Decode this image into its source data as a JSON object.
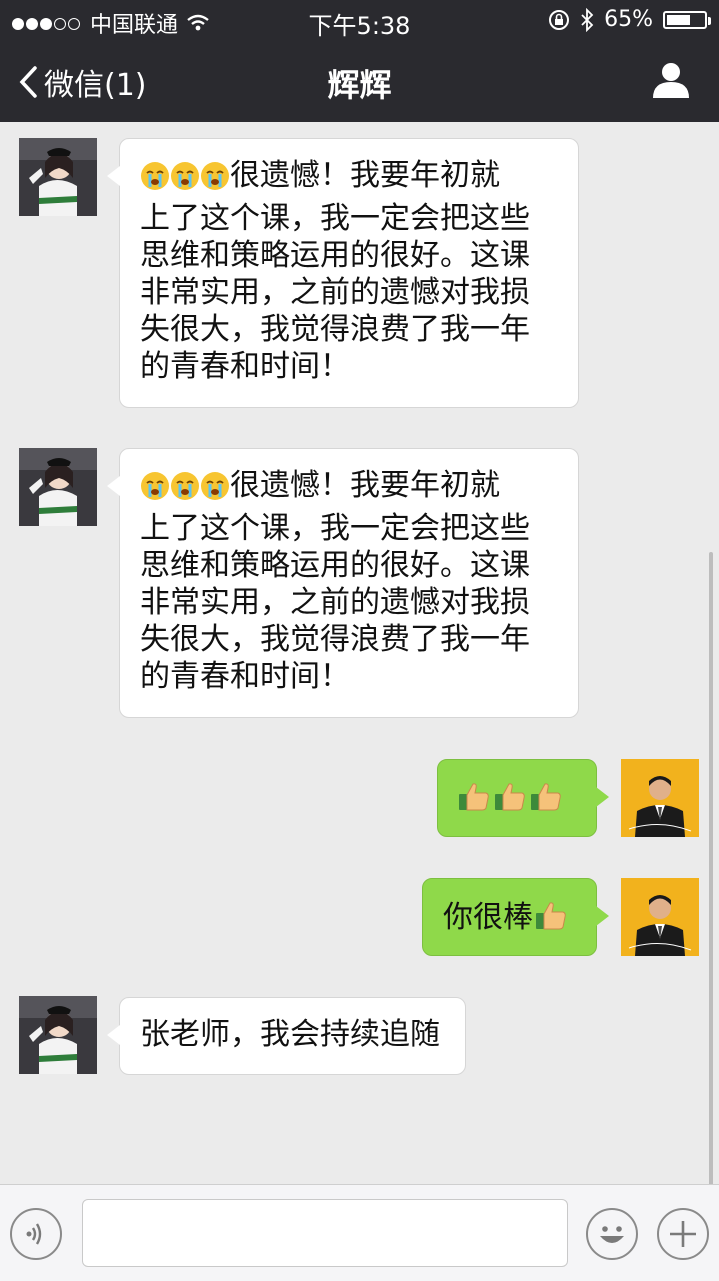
{
  "status_bar": {
    "carrier": "中国联通",
    "time": "下午5:38",
    "battery_percent": "65%",
    "battery_level": 0.65,
    "signal_dots": [
      true,
      true,
      true,
      false,
      false
    ]
  },
  "nav": {
    "back_label": "微信(1)",
    "title": "辉辉"
  },
  "messages": [
    {
      "sender": "other",
      "text": "很遗憾！我要年初就上了这个课，我一定会把这些思维和策略运用的很好。这课非常实用，之前的遗憾对我损失很大，我觉得浪费了我一年的青春和时间！",
      "lines": [
        "很遗憾！我要年初就",
        "上了这个课，我一定会把这些",
        "思维和策略运用的很好。这课",
        "非常实用，之前的遗憾对我损",
        "失很大，我觉得浪费了我一年",
        "的青春和时间！"
      ],
      "leading_emoji": [
        "crying-face-icon",
        "crying-face-icon",
        "crying-face-icon"
      ]
    },
    {
      "sender": "other",
      "text": "很遗憾！我要年初就上了这个课，我一定会把这些思维和策略运用的很好。这课非常实用，之前的遗憾对我损失很大，我觉得浪费了我一年的青春和时间！",
      "lines": [
        "很遗憾！我要年初就",
        "上了这个课，我一定会把这些",
        "思维和策略运用的很好。这课",
        "非常实用，之前的遗憾对我损",
        "失很大，我觉得浪费了我一年",
        "的青春和时间！"
      ],
      "leading_emoji": [
        "crying-face-icon",
        "crying-face-icon",
        "crying-face-icon"
      ]
    },
    {
      "sender": "me",
      "emoji_only": [
        "thumbs-up-icon",
        "thumbs-up-icon",
        "thumbs-up-icon"
      ]
    },
    {
      "sender": "me",
      "text": "你很棒",
      "trailing_emoji": [
        "thumbs-up-icon"
      ]
    },
    {
      "sender": "other",
      "text": "张老师，我会持续追随"
    }
  ],
  "colors": {
    "nav_bg": "#2a2a2f",
    "chat_bg": "#ebebeb",
    "bubble_in": "#ffffff",
    "bubble_out": "#8fd94a"
  }
}
